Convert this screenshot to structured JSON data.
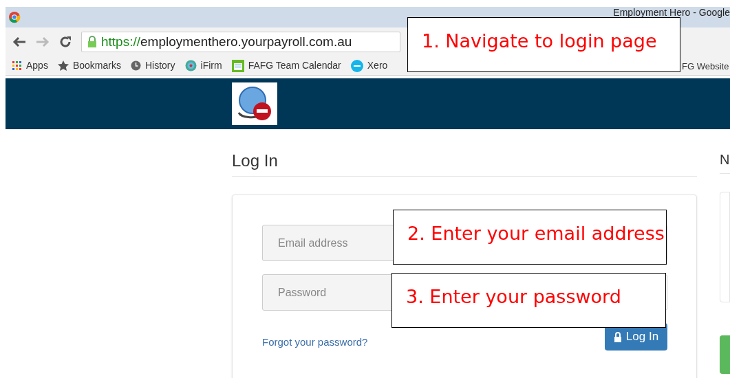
{
  "browser": {
    "title": "Employment Hero - Google",
    "url_scheme": "https://",
    "url_rest": "employmenthero.yourpayroll.com.au",
    "bookmarks": [
      {
        "label": "Apps",
        "kind": "apps"
      },
      {
        "label": "Bookmarks",
        "kind": "star"
      },
      {
        "label": "History",
        "kind": "clock"
      },
      {
        "label": "iFirm",
        "kind": "globe"
      },
      {
        "label": "FAFG Team Calendar",
        "kind": "calendar"
      },
      {
        "label": "Xero",
        "kind": "xero"
      },
      {
        "label": "FG Website",
        "kind": "none"
      }
    ]
  },
  "login": {
    "heading": "Log In",
    "email_placeholder": "Email address",
    "password_placeholder": "Password",
    "forgot_link": "Forgot your password?",
    "button": "Log In"
  },
  "side_heading": "N",
  "callouts": [
    {
      "text": "1. Navigate to login page"
    },
    {
      "text": "2. Enter your email address"
    },
    {
      "text": "3. Enter your password"
    }
  ]
}
